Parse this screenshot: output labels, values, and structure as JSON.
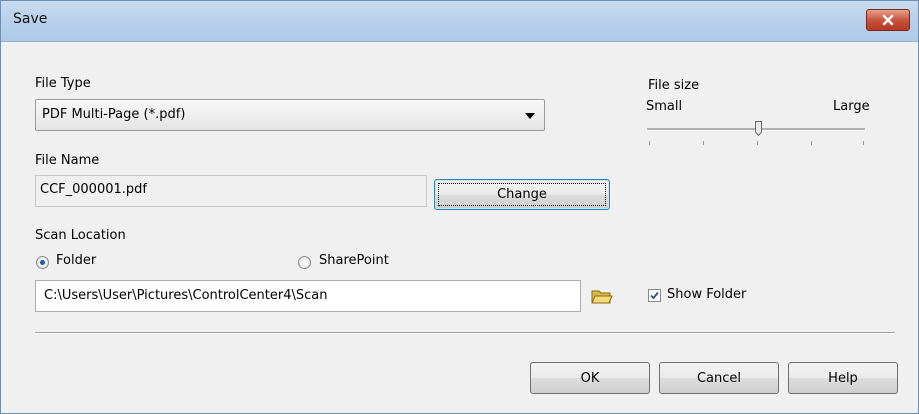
{
  "window": {
    "title": "Save",
    "close_icon": "close-icon"
  },
  "file_type": {
    "label": "File Type",
    "selected": "PDF Multi-Page (*.pdf)"
  },
  "file_size": {
    "label": "File size",
    "min_label": "Small",
    "max_label": "Large",
    "level": 0.5
  },
  "file_name": {
    "label": "File Name",
    "value": "CCF_000001.pdf",
    "change_label": "Change"
  },
  "scan_location": {
    "label": "Scan Location",
    "options": [
      {
        "label": "Folder",
        "checked": true
      },
      {
        "label": "SharePoint",
        "checked": false
      }
    ],
    "path": "C:\\Users\\User\\Pictures\\ControlCenter4\\Scan",
    "browse_icon": "folder-icon",
    "show_folder_label": "Show Folder",
    "show_folder_checked": true
  },
  "buttons": {
    "ok": "OK",
    "cancel": "Cancel",
    "help": "Help"
  }
}
